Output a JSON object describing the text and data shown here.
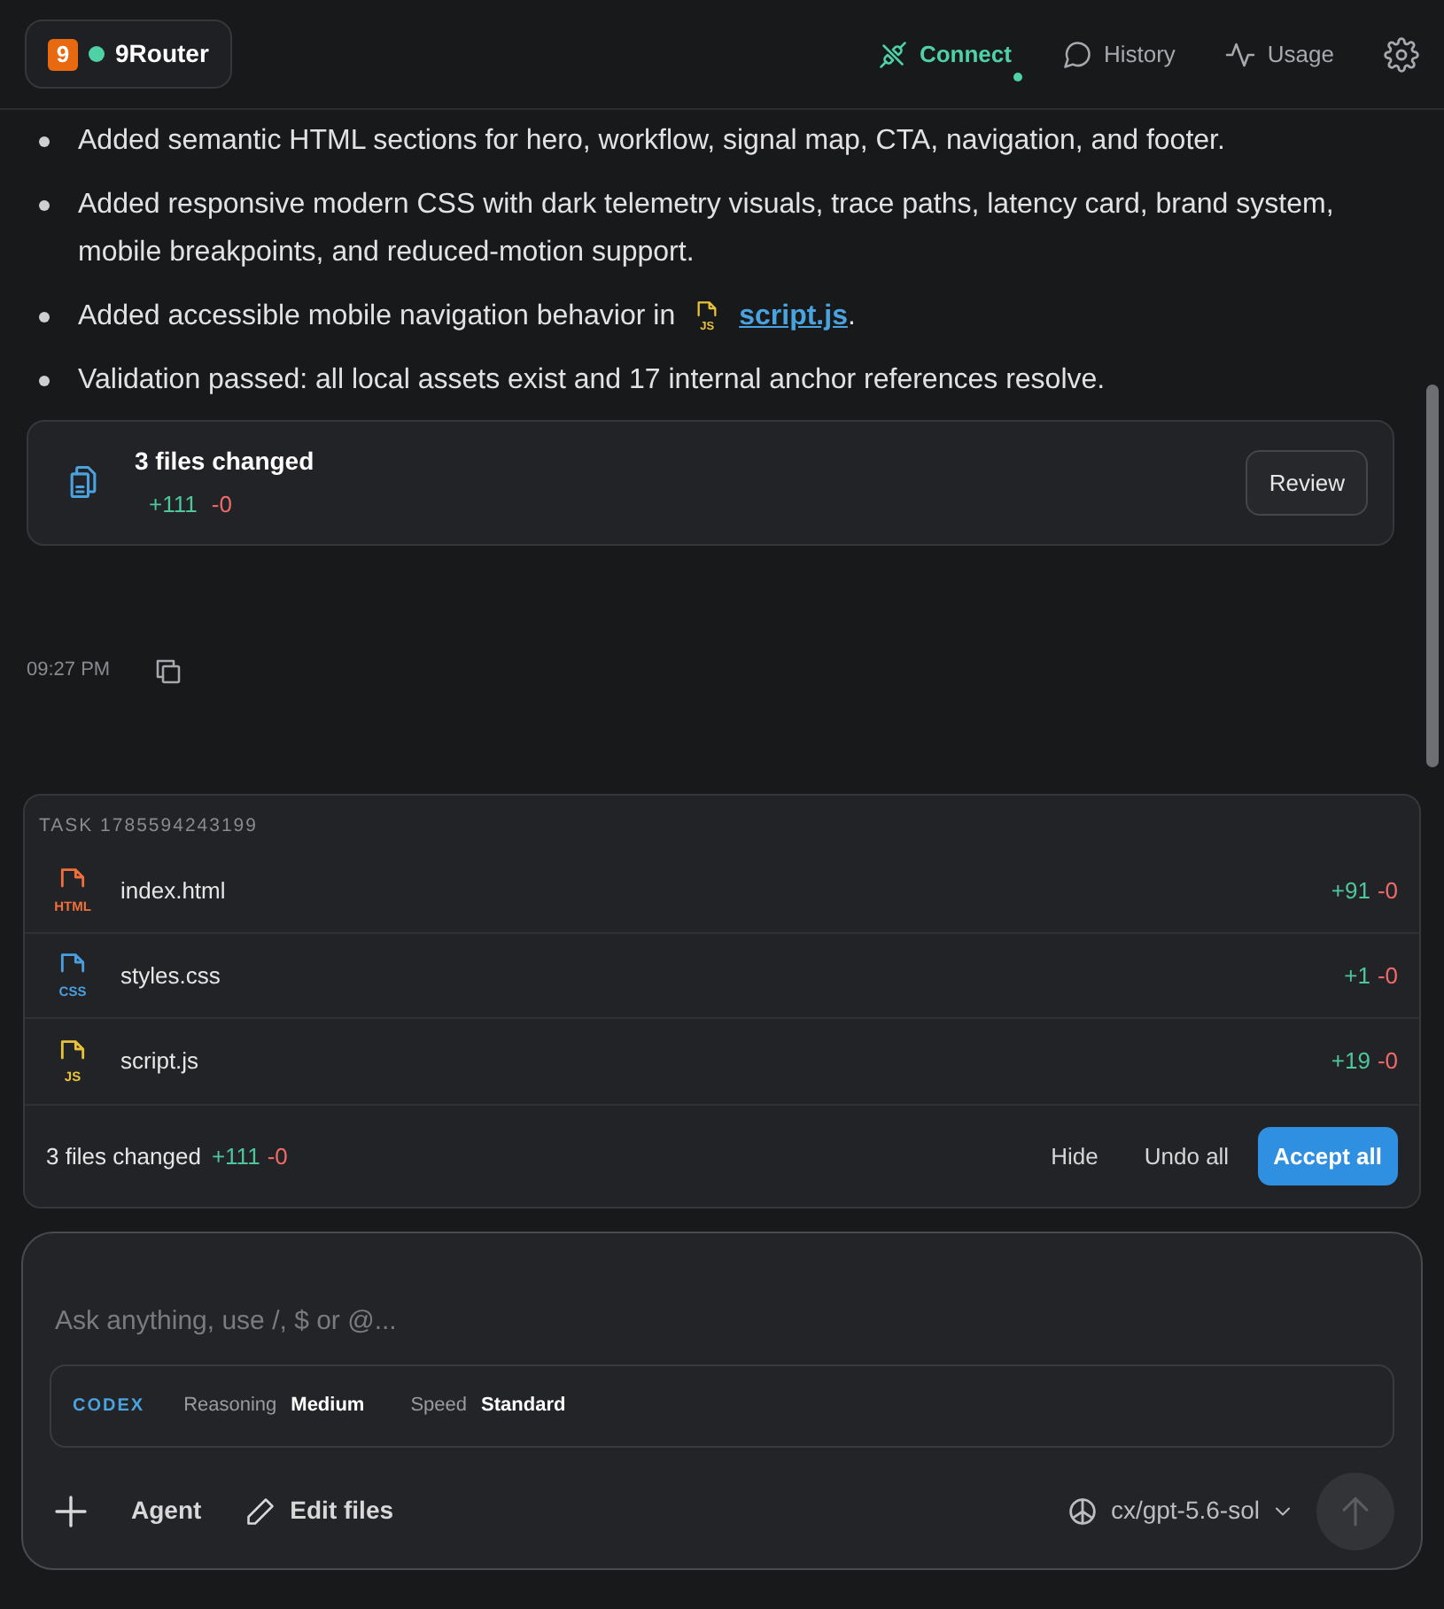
{
  "header": {
    "brand": {
      "badge": "9",
      "name": "9Router"
    },
    "nav": [
      {
        "label": "Connect",
        "selected": true
      },
      {
        "label": "History",
        "selected": false
      },
      {
        "label": "Usage",
        "selected": false
      }
    ]
  },
  "message": {
    "bullets": [
      {
        "text": "Added semantic HTML sections for hero, workflow, signal map, CTA, navigation, and footer."
      },
      {
        "text": "Added responsive modern CSS with dark telemetry visuals, trace paths, latency card, brand system, mobile breakpoints, and reduced-motion support."
      },
      {
        "text": "Added accessible mobile navigation behavior in",
        "file": {
          "name": "script.js",
          "color": "#e8c23a",
          "badge": "JS"
        },
        "after": "."
      },
      {
        "text": "Validation passed: all local assets exist and 17 internal anchor references resolve."
      }
    ],
    "summary": {
      "title": "3 files changed",
      "added": "+111",
      "removed": "-0",
      "button": "Review"
    },
    "time": "09:27 PM"
  },
  "task": {
    "label": "TASK 1785594243199",
    "files": [
      {
        "name": "index.html",
        "color": "#f0703c",
        "badge": "HTML",
        "added": "+91",
        "removed": "-0"
      },
      {
        "name": "styles.css",
        "color": "#4a9fe0",
        "badge": "CSS",
        "added": "+1",
        "removed": "-0"
      },
      {
        "name": "script.js",
        "color": "#e8c23a",
        "badge": "JS",
        "added": "+19",
        "removed": "-0"
      }
    ],
    "footer": {
      "summary": "3 files changed",
      "added": "+111",
      "removed": "-0",
      "buttons": [
        {
          "label": "Hide",
          "kind": "text"
        },
        {
          "label": "Undo all",
          "kind": "text"
        },
        {
          "label": "Accept all",
          "kind": "primary"
        }
      ]
    }
  },
  "composer": {
    "placeholder": "Ask anything, use /, $ or @...",
    "provider": "CODEX",
    "settings": [
      {
        "label": "Reasoning",
        "value": "Medium"
      },
      {
        "label": "Speed",
        "value": "Standard"
      }
    ],
    "mode": "Agent",
    "edit": "Edit files",
    "model": "cx/gpt-5.6-sol",
    "send_disabled": true
  }
}
